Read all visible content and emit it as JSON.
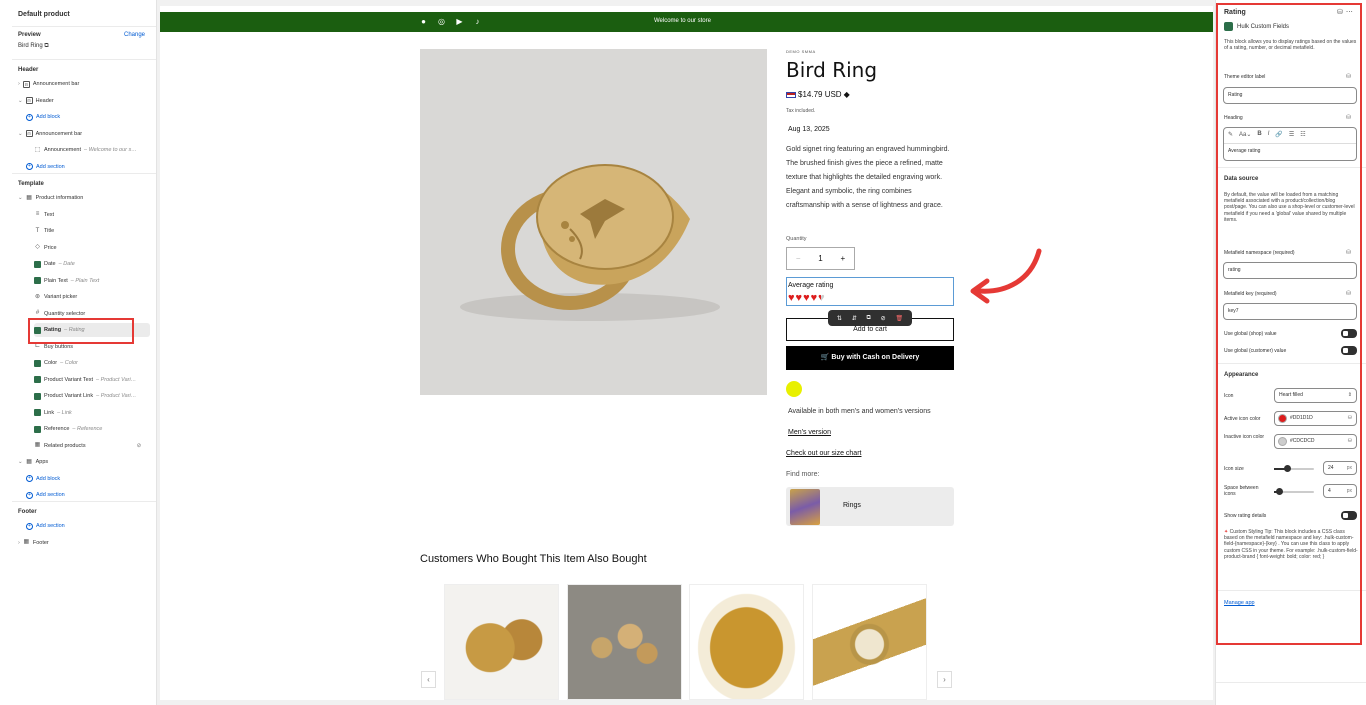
{
  "left": {
    "page_title": "Default product",
    "preview_label": "Preview",
    "change_label": "Change",
    "preview_product": "Bird Ring",
    "header_section": "Header",
    "header_items": [
      {
        "label": "Announcement bar",
        "icon": "announcement-bar-icon",
        "prefix": "›"
      },
      {
        "label": "Header",
        "icon": "header-icon",
        "prefix": "⌄"
      },
      {
        "label": "Add block",
        "icon": "plus-circle-icon",
        "kind": "add"
      },
      {
        "label": "Announcement bar",
        "icon": "announcement-bar-icon",
        "prefix": "⌄"
      },
      {
        "label": "Announcement",
        "sub": "Welcome to our s…",
        "icon": "block-icon"
      },
      {
        "label": "Add section",
        "icon": "plus-circle-icon",
        "kind": "add"
      }
    ],
    "template_section": "Template",
    "template_items": [
      {
        "label": "Product information",
        "icon": "section-icon",
        "prefix": "⌄"
      },
      {
        "label": "Text",
        "icon": "text-icon"
      },
      {
        "label": "Title",
        "icon": "title-icon"
      },
      {
        "label": "Price",
        "icon": "price-tag-icon"
      },
      {
        "label": "Date",
        "sub": "Date",
        "icon": "app-block-icon"
      },
      {
        "label": "Plain Text",
        "sub": "Plain Text",
        "icon": "app-block-icon"
      },
      {
        "label": "Variant picker",
        "icon": "variant-icon"
      },
      {
        "label": "Quantity selector",
        "icon": "quantity-icon"
      },
      {
        "label": "Rating",
        "sub": "Rating",
        "icon": "app-block-icon",
        "selected": true
      },
      {
        "label": "Buy buttons",
        "icon": "cart-icon"
      },
      {
        "label": "Color",
        "sub": "Color",
        "icon": "app-block-icon"
      },
      {
        "label": "Product Variant Text",
        "sub": "Product Vari…",
        "icon": "app-block-icon"
      },
      {
        "label": "Product Variant Link",
        "sub": "Product Vari…",
        "icon": "app-block-icon"
      },
      {
        "label": "Link",
        "sub": "Link",
        "icon": "app-block-icon"
      },
      {
        "label": "Reference",
        "sub": "Reference",
        "icon": "app-block-icon"
      },
      {
        "label": "Related products",
        "icon": "section-icon",
        "trail": "eye-slash-icon"
      },
      {
        "label": "Apps",
        "icon": "section-icon",
        "prefix": "⌄"
      },
      {
        "label": "Add block",
        "icon": "plus-circle-icon",
        "kind": "add"
      },
      {
        "label": "Add section",
        "icon": "plus-circle-icon",
        "kind": "add"
      }
    ],
    "footer_section": "Footer",
    "footer_items": [
      {
        "label": "Add section",
        "icon": "plus-circle-icon",
        "kind": "add"
      },
      {
        "label": "Footer",
        "icon": "section-icon",
        "prefix": "›"
      }
    ]
  },
  "preview": {
    "announcement": "Welcome to our store",
    "vendor": "DEMO SMMA",
    "title": "Bird Ring",
    "price": "$14.79 USD",
    "tax": "Tax included.",
    "date": "Aug 13, 2025",
    "description": "Gold signet ring featuring an engraved hummingbird. The brushed finish gives the piece a refined, matte texture that highlights the detailed engraving work. Elegant and symbolic, the ring combines craftsmanship with a sense of lightness and grace.",
    "quantity_label": "Quantity",
    "quantity_value": "1",
    "rating_heading": "Average rating",
    "rating_value": 4.5,
    "rating_max": 5,
    "add_to_cart": "Add to cart",
    "buy_cod": "Buy with Cash on Delivery",
    "swatch_color": "#e8f000",
    "availability": "Available in both men's and women's versions",
    "mens_link": "Men's version",
    "size_chart_link": "Check out our size chart",
    "find_more": "Find more:",
    "find_more_item": "Rings",
    "related_heading": "Customers Who Bought This Item Also Bought",
    "prev_arrow": "‹",
    "next_arrow": "›"
  },
  "right": {
    "title": "Rating",
    "app_name": "Hulk Custom Fields",
    "description": "This block allows you to display ratings based on the values of a rating, number, or decimal metafield.",
    "editor_label_label": "Theme editor label",
    "editor_label_value": "Rating",
    "heading_label": "Heading",
    "heading_value": "Average rating",
    "data_source_title": "Data source",
    "data_source_desc": "By default, the value will be loaded from a matching metafield associated with a product/collection/blog post/page. You can also use a shop-level or customer-level metafield if you need a 'global' value shared by multiple items.",
    "namespace_label": "Metafield namespace (required)",
    "namespace_value": "rating",
    "key_label": "Metafield key (required)",
    "key_value": "key7",
    "global_shop_label": "Use global (shop) value",
    "global_customer_label": "Use global (customer) value",
    "appearance_title": "Appearance",
    "icon_label": "Icon",
    "icon_value": "Heart filled",
    "active_color_label": "Active icon color",
    "active_color_value": "#DD1D1D",
    "inactive_color_label": "Inactive icon color",
    "inactive_color_value": "#CDCDCD",
    "icon_size_label": "Icon size",
    "icon_size_value": "24",
    "space_label": "Space between icons",
    "space_value": "4",
    "unit": "px",
    "show_details_label": "Show rating details",
    "tip": "Custom Styling Tip: This block includes a CSS class based on the metafield namespace and key: .hulk-custom-field-{namespace}-{key} . You can use this class to apply custom CSS in your theme. For example: .hulk-custom-field-product-brand { font-weight: bold; color: red; }",
    "manage_app": "Manage app"
  },
  "colors": {
    "announcement_bg": "#1b5e10",
    "highlight": "#e53935",
    "link_blue": "#005bd3"
  }
}
